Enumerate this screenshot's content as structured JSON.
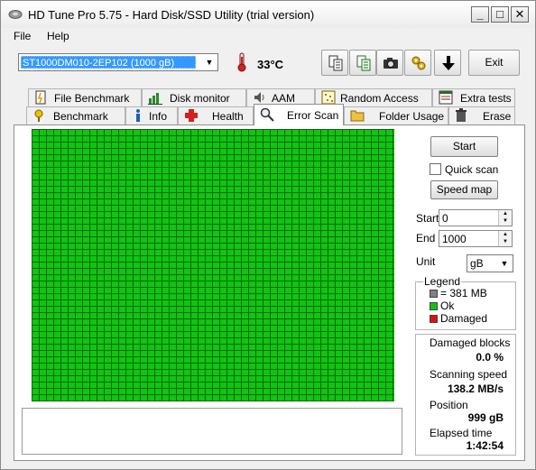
{
  "window": {
    "title": "HD Tune Pro 5.75 - Hard Disk/SSD Utility (trial version)",
    "controls": {
      "minimize": "_",
      "maximize": "□",
      "close": "✕"
    }
  },
  "menu": {
    "file": "File",
    "help": "Help"
  },
  "toolbar": {
    "drive": "ST1000DM010-2EP102 (1000 gB)",
    "temperature": "33°C",
    "exit_label": "Exit"
  },
  "tabs": {
    "top": [
      {
        "label": "File Benchmark",
        "icon": "file-benchmark-icon"
      },
      {
        "label": "Disk monitor",
        "icon": "disk-monitor-icon"
      },
      {
        "label": "AAM",
        "icon": "speaker-icon"
      },
      {
        "label": "Random Access",
        "icon": "random-access-icon"
      },
      {
        "label": "Extra tests",
        "icon": "extra-tests-icon"
      }
    ],
    "bottom": [
      {
        "label": "Benchmark",
        "icon": "benchmark-icon"
      },
      {
        "label": "Info",
        "icon": "info-icon"
      },
      {
        "label": "Health",
        "icon": "health-icon"
      },
      {
        "label": "Error Scan",
        "icon": "magnifier-icon",
        "active": true
      },
      {
        "label": "Folder Usage",
        "icon": "folder-icon"
      },
      {
        "label": "Erase",
        "icon": "trash-icon"
      }
    ]
  },
  "controls": {
    "start_button": "Start",
    "quick_scan_label": "Quick scan",
    "quick_scan_checked": false,
    "speed_map_button": "Speed map",
    "start_label": "Start",
    "start_value": "0",
    "end_label": "End",
    "end_value": "1000",
    "unit_label": "Unit",
    "unit_value": "gB"
  },
  "legend": {
    "title": "Legend",
    "items": [
      {
        "label": "= 381 MB",
        "color": "#808080"
      },
      {
        "label": "Ok",
        "color": "#11c411"
      },
      {
        "label": "Damaged",
        "color": "#e01010"
      }
    ]
  },
  "stats": {
    "damaged_blocks_label": "Damaged blocks",
    "damaged_blocks_value": "0.0 %",
    "scanning_speed_label": "Scanning speed",
    "scanning_speed_value": "138.2 MB/s",
    "position_label": "Position",
    "position_value": "999 gB",
    "elapsed_label": "Elapsed time",
    "elapsed_value": "1:42:54"
  },
  "scan_grid": {
    "status": "Ok",
    "ok_color": "#11c411"
  }
}
